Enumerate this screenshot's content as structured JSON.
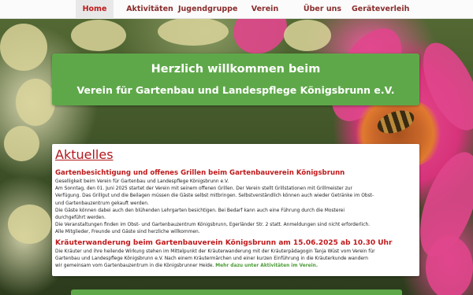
{
  "nav": {
    "items": [
      {
        "label": "Home",
        "active": true
      },
      {
        "label": "Aktivitäten",
        "active": false
      },
      {
        "label": "Jugendgruppe",
        "active": false
      },
      {
        "label": "Verein",
        "active": false
      },
      {
        "label": "Über uns",
        "active": false
      },
      {
        "label": "Geräteverleih",
        "active": false
      }
    ]
  },
  "welcome": {
    "line1": "Herzlich willkommen beim",
    "line2": "Verein für Gartenbau und Landespflege Königsbrunn e.V."
  },
  "news": {
    "heading": "Aktuelles",
    "article1": {
      "title": "Gartenbesichtigung und offenes Grillen beim Gartenbauverein Königsbrunn",
      "lines": [
        "Geselligkeit beim Verein für Gartenbau und Landespflege Königsbrunn e.V.",
        "Am Sonntag, den 01. Juni 2025 startet der Verein mit seinem offenen Grillen. Der Verein stellt Grillstationen mit Grillmeister zur",
        "Verfügung. Das Grillgut und die Beilagen müssen die Gäste selbst mitbringen. Selbstverständlich können auch wieder Getränke im Obst-",
        "und Gartenbauzentrum gekauft werden.",
        "Die Gäste können dabei auch den blühenden Lehrgarten besichtigen. Bei Bedarf kann auch eine Führung durch die Mosterei",
        "durchgeführt werden.",
        "Die Veranstaltungen finden im Obst- und Gartenbauzentrum Königsbrunn, Egerländer Str. 2 statt. Anmeldungen sind nicht erforderlich.",
        "Alle Mitglieder, Freunde und Gäste sind herzliche willkommen."
      ]
    },
    "article2": {
      "title": "Kräuterwanderung beim Gartenbauverein Königsbrunn am 15.06.2025 ab 10.30 Uhr",
      "lines": [
        "Die Kräuter und ihre heilende Wirkung stehen im Mittelpunkt der Kräuterwanderung mit der Kräuterpädagogin Tanja Wüst vom Verein für",
        "Gartenbau und Landespflege Königsbrunn e.V. Nach einem Kräutermärchen und einer kurzen Einführung in die Kräuterkunde wandern"
      ],
      "last_line": "wir gemeinsam vom Gartenbauzentrum in die Königsbrunner Heide.",
      "more_link": "Mehr dazu unter Aktivitäten im Verein."
    }
  },
  "colors": {
    "nav_text": "#8a2d2d",
    "nav_active": "#c0191b",
    "banner_green": "#5fa84a",
    "heading_red": "#b3171c",
    "link_green": "#4a9a35"
  }
}
